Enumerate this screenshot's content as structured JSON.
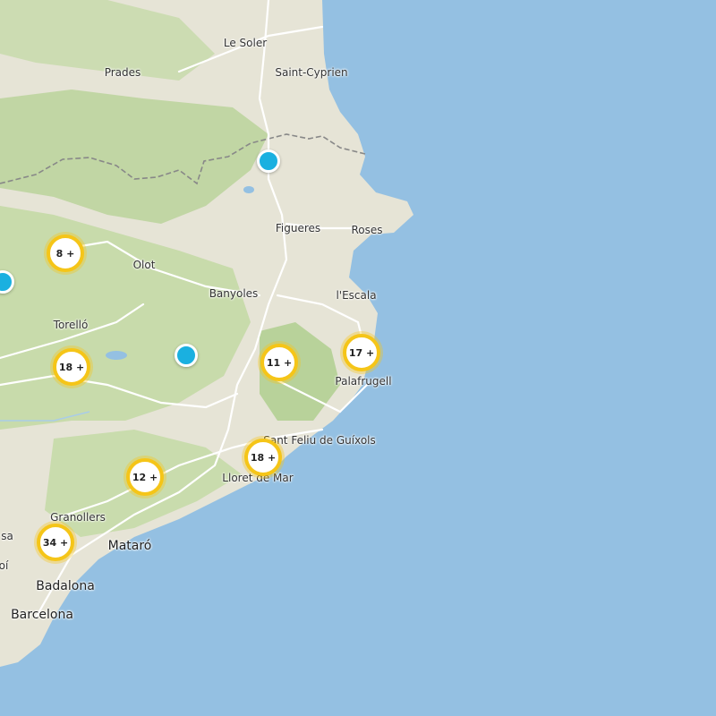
{
  "places": [
    {
      "id": "le-soler",
      "label": "Le Soler"
    },
    {
      "id": "saint-cyprien",
      "label": "Saint-Cyprien"
    },
    {
      "id": "prades",
      "label": "Prades"
    },
    {
      "id": "figueres",
      "label": "Figueres"
    },
    {
      "id": "roses",
      "label": "Roses"
    },
    {
      "id": "olot",
      "label": "Olot"
    },
    {
      "id": "banyoles",
      "label": "Banyoles"
    },
    {
      "id": "lescala",
      "label": "l'Escala"
    },
    {
      "id": "torello",
      "label": "Torelló"
    },
    {
      "id": "palafrugell",
      "label": "Palafrugell"
    },
    {
      "id": "sant-feliu",
      "label": "Sant Feliu de Guíxols"
    },
    {
      "id": "lloret",
      "label": "Lloret de Mar"
    },
    {
      "id": "granollers",
      "label": "Granollers"
    },
    {
      "id": "mataro",
      "label": "Mataró"
    },
    {
      "id": "badalona",
      "label": "Badalona"
    },
    {
      "id": "barcelona",
      "label": "Barcelona"
    },
    {
      "id": "sa-fragment",
      "label": "sa"
    },
    {
      "id": "oi-fragment",
      "label": "oí"
    }
  ],
  "clusters": [
    {
      "id": "c1",
      "label": "8 +"
    },
    {
      "id": "c2",
      "label": "18 +"
    },
    {
      "id": "c3",
      "label": "11 +"
    },
    {
      "id": "c4",
      "label": "17 +"
    },
    {
      "id": "c5",
      "label": "18 +"
    },
    {
      "id": "c6",
      "label": "12 +"
    },
    {
      "id": "c7",
      "label": "34 +"
    }
  ],
  "markers": [
    {
      "id": "m1"
    },
    {
      "id": "m2"
    },
    {
      "id": "m3"
    }
  ],
  "colors": {
    "sea": "#94c0e2",
    "land": "#e6e4d6",
    "forest": "#b8d29a",
    "cluster_ring": "#f5c518",
    "marker": "#1ab0e0"
  }
}
